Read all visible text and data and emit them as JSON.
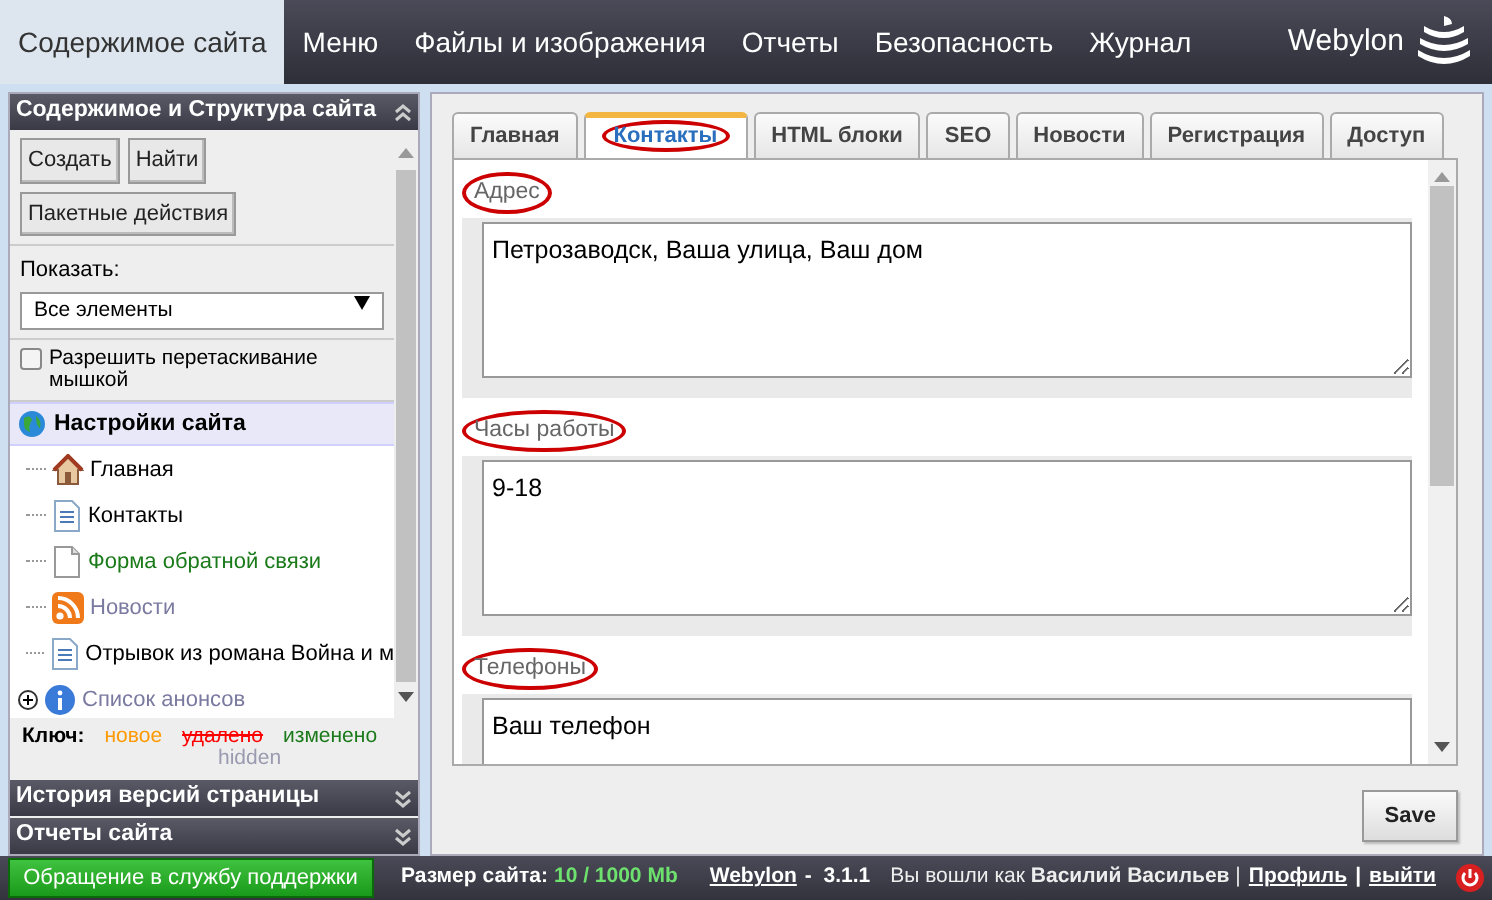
{
  "nav": {
    "items": [
      {
        "label": "Содержимое сайта",
        "selected": true
      },
      {
        "label": "Меню",
        "selected": false
      },
      {
        "label": "Файлы и изображения",
        "selected": false
      },
      {
        "label": "Отчеты",
        "selected": false
      },
      {
        "label": "Безопасность",
        "selected": false
      },
      {
        "label": "Журнал",
        "selected": false
      }
    ],
    "brand": "Webylon"
  },
  "sidebar": {
    "title": "Содержимое и Структура сайта",
    "buttons": [
      "Создать",
      "Найти",
      "Пакетные действия"
    ],
    "show_label": "Показать:",
    "show_value": "Все элементы",
    "drag_checkbox": {
      "label": "Разрешить перетаскивание мышкой",
      "checked": false
    },
    "tree": [
      {
        "label": "Настройки сайта",
        "kind": "globe",
        "color": "#000000",
        "selected": true,
        "children": [
          {
            "label": "Главная",
            "kind": "home",
            "color": "#000000",
            "selected": false
          },
          {
            "label": "Контакты",
            "kind": "page",
            "color": "#000000",
            "selected": false
          },
          {
            "label": "Форма обратной связи",
            "kind": "blank",
            "color": "#1a7a1a",
            "selected": false
          },
          {
            "label": "Новости",
            "kind": "rss",
            "color": "#7a7aa0",
            "selected": false
          },
          {
            "label": "Отрывок из романа Война и м",
            "kind": "page",
            "color": "#000000",
            "selected": false
          },
          {
            "label": "Список анонсов",
            "kind": "info",
            "color": "#7a7aa0",
            "selected": false,
            "expanded": false
          }
        ]
      }
    ],
    "legend_label": "Ключ:",
    "legend": [
      {
        "label": "новое",
        "color": "#ff9900",
        "strikethrough": false
      },
      {
        "label": "удалено",
        "color": "#ff0000",
        "strikethrough": true
      },
      {
        "label": "изменено",
        "color": "#1a7a1a",
        "strikethrough": false
      },
      {
        "label": "hidden",
        "color": "#9a9ab0",
        "strikethrough": false
      }
    ],
    "sections": [
      {
        "title": "История версий страницы",
        "expanded": false
      },
      {
        "title": "Отчеты сайта",
        "expanded": false
      }
    ]
  },
  "tabs": [
    {
      "label": "Главная",
      "selected": false,
      "circled": false
    },
    {
      "label": "Контакты",
      "selected": true,
      "circled": true
    },
    {
      "label": "HTML блоки",
      "selected": false,
      "circled": false
    },
    {
      "label": "SEO",
      "selected": false,
      "circled": false
    },
    {
      "label": "Новости",
      "selected": false,
      "circled": false
    },
    {
      "label": "Регистрация",
      "selected": false,
      "circled": false
    },
    {
      "label": "Доступ",
      "selected": false,
      "circled": false
    }
  ],
  "fields": [
    {
      "label": "Адрес",
      "value": "Петрозаводск, Ваша улица, Ваш дом",
      "circled": true
    },
    {
      "label": "Часы работы",
      "value": "9-18",
      "circled": true
    },
    {
      "label": "Телефоны",
      "value": "Ваш телефон",
      "circled": true
    }
  ],
  "save_button": "Save",
  "status_bar": {
    "support_button": "Обращение в службу поддержки",
    "size_label": "Размер сайта:",
    "size_value": "10 / 1000 Mb",
    "product_link": "Webylon",
    "version": "-  3.1.1",
    "login_text": "Вы вошли как **Василий Васильев** |",
    "profile_link": "Профиль",
    "separator": "|",
    "logout_link": "выйти"
  }
}
